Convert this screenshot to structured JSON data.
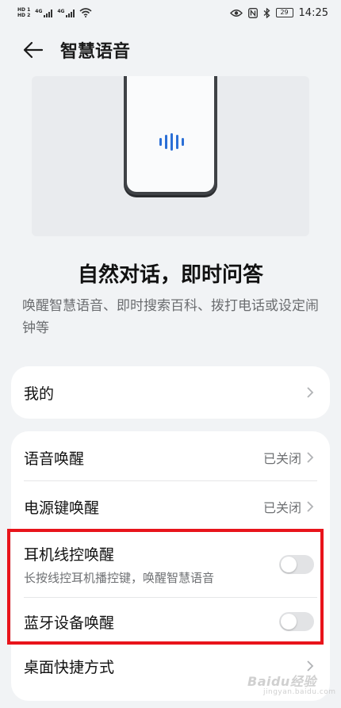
{
  "status_bar": {
    "hd1": "HD 1",
    "hd2": "HD 2",
    "net1": "4G",
    "net2": "4G",
    "battery": "29",
    "time": "14:25"
  },
  "header": {
    "title": "智慧语音"
  },
  "intro": {
    "title": "自然对话，即时问答",
    "description": "唤醒智慧语音、即时搜索百科、拨打电话或设定闹钟等"
  },
  "sections": {
    "mine": {
      "label": "我的"
    },
    "voice_wake": {
      "label": "语音唤醒",
      "value": "已关闭"
    },
    "power_key_wake": {
      "label": "电源键唤醒",
      "value": "已关闭"
    },
    "headset_wake": {
      "label": "耳机线控唤醒",
      "subtitle": "长按线控耳机播控键，唤醒智慧语音",
      "enabled": false
    },
    "bluetooth_wake": {
      "label": "蓝牙设备唤醒",
      "enabled": false
    },
    "desktop_shortcut": {
      "label": "桌面快捷方式"
    }
  },
  "watermark": {
    "text": "Baidu经验",
    "sub": "jingyan.baidu.com"
  },
  "colors": {
    "highlight": "#e8141b",
    "voice_icon": "#2b6fd6",
    "background": "#f1f3f5"
  }
}
